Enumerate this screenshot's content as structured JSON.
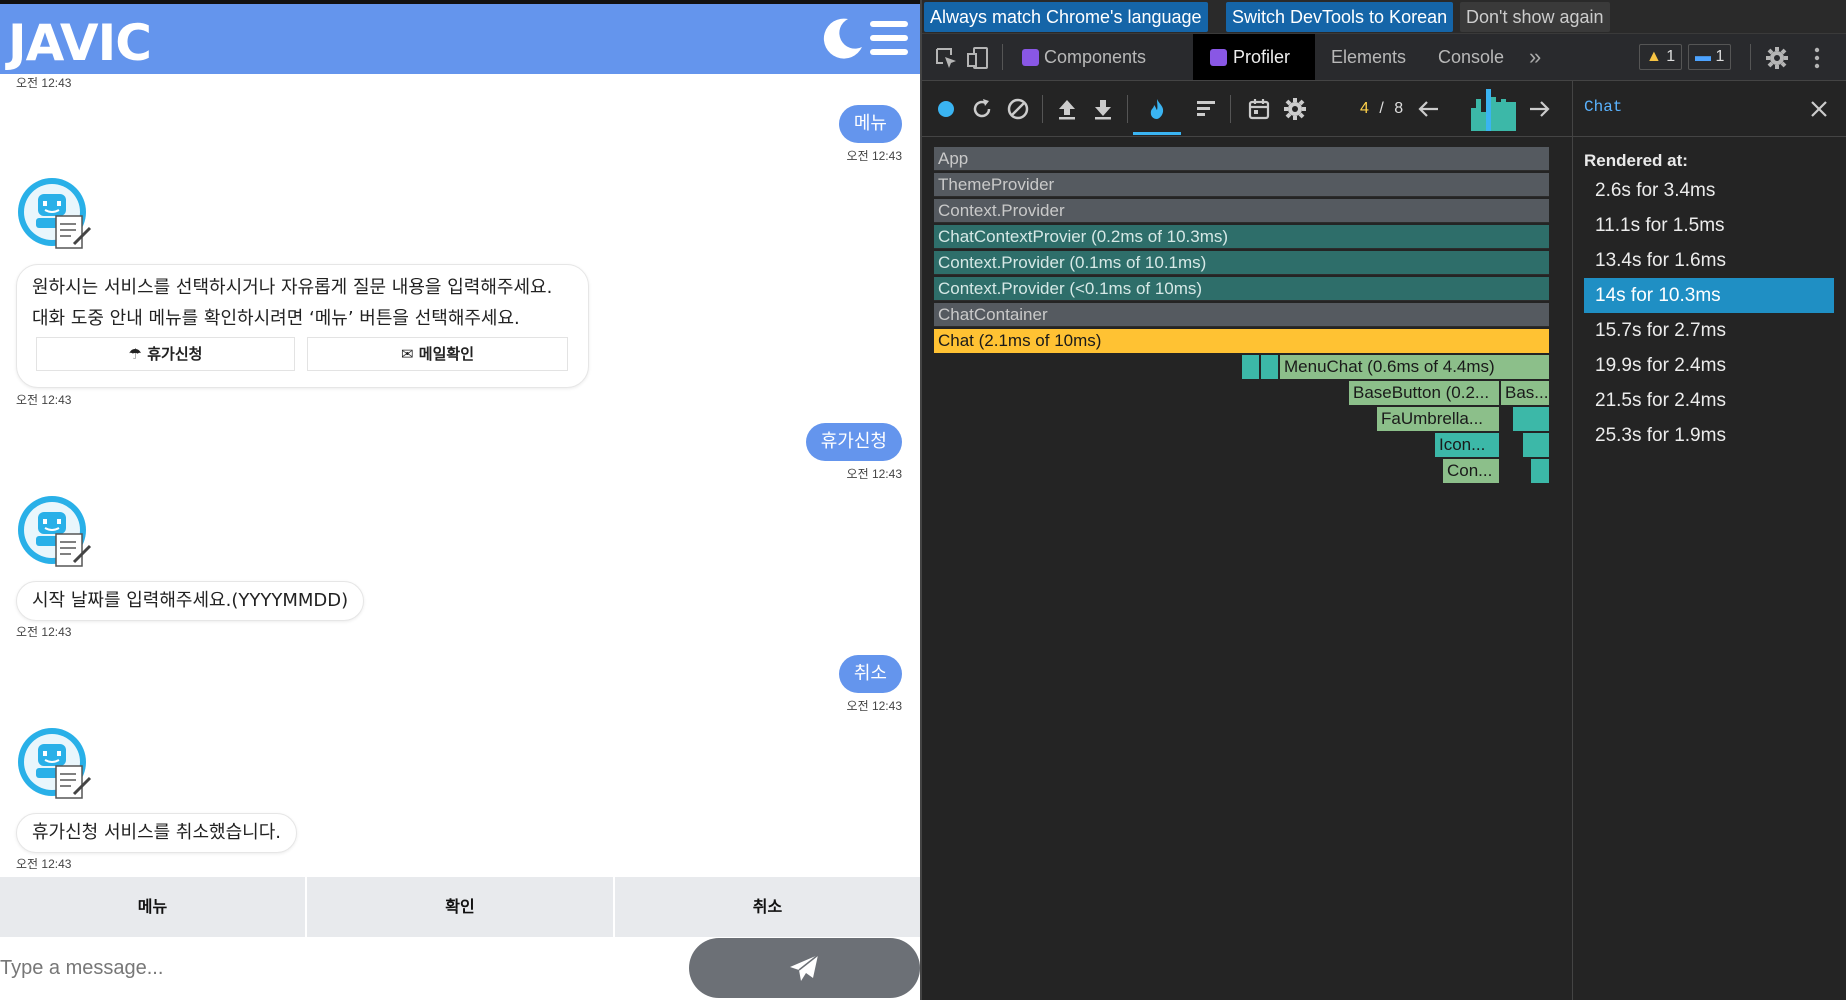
{
  "chat": {
    "brand": "JAVIC",
    "messages": [
      {
        "type": "time",
        "text": "오전 12:43"
      },
      {
        "type": "user",
        "text": "메뉴",
        "time": "오전 12:43"
      },
      {
        "type": "bot",
        "lines": [
          "원하시는 서비스를 선택하시거나 자유롭게 질문 내용을 입력해주세요.",
          "대화 도중 안내 메뉴를 확인하시려면 ‘메뉴’ 버튼을 선택해주세요."
        ],
        "buttons": [
          "휴가신청",
          "메일확인"
        ],
        "time": "오전 12:43"
      },
      {
        "type": "user",
        "text": "휴가신청",
        "time": "오전 12:43"
      },
      {
        "type": "bot",
        "lines": [
          "시작 날짜를 입력해주세요.(YYYYMMDD)"
        ],
        "time": "오전 12:43"
      },
      {
        "type": "user",
        "text": "취소",
        "time": "오전 12:43"
      },
      {
        "type": "bot",
        "lines": [
          "휴가신청 서비스를 취소했습니다."
        ],
        "time": "오전 12:43"
      }
    ],
    "quick_buttons": [
      "메뉴",
      "확인",
      "취소"
    ],
    "input_placeholder": "Type a message...",
    "colors": {
      "header": "#6495ed",
      "user_bubble": "#6495ed",
      "send_button": "#6c7076"
    },
    "icons": {
      "theme_toggle": "moon-icon",
      "menu": "hamburger-icon",
      "send": "paper-plane-icon",
      "bot": "robot-document-icon",
      "vacation": "umbrella-icon",
      "mail": "envelope-icon"
    }
  },
  "devtools": {
    "infobar": {
      "match_language": "Always match Chrome's language",
      "switch_korean": "Switch DevTools to Korean",
      "dont_show": "Don't show again"
    },
    "tabs": [
      "Components",
      "Profiler",
      "Elements",
      "Console"
    ],
    "active_tab": "Profiler",
    "warnings_count": "1",
    "messages_count": "1",
    "commit": {
      "current": "4",
      "separator": "/",
      "total": "8"
    },
    "commit_bars": [
      0.55,
      0.75,
      0.45,
      1.0,
      0.8,
      0.7,
      0.75,
      0.7,
      0.7
    ],
    "flamegraph": {
      "rows": [
        {
          "label": "App",
          "style": "gray"
        },
        {
          "label": "ThemeProvider",
          "style": "gray"
        },
        {
          "label": "Context.Provider",
          "style": "gray"
        },
        {
          "label": "ChatContextProvier (0.2ms of 10.3ms)",
          "style": "teal"
        },
        {
          "label": "Context.Provider (0.1ms of 10.1ms)",
          "style": "teal"
        },
        {
          "label": "Context.Provider (<0.1ms of 10ms)",
          "style": "teal"
        },
        {
          "label": "ChatContainer",
          "style": "gray"
        },
        {
          "label": "Chat (2.1ms of 10ms)",
          "style": "yellow"
        }
      ],
      "children": [
        "MenuChat (0.6ms of 4.4ms)",
        "BaseButton (0.2...",
        "Bas...",
        "FaUmbrella...",
        "Icon...",
        "Con..."
      ]
    },
    "sidebar": {
      "title": "Chat",
      "label": "Rendered at:",
      "renders": [
        "2.6s for 3.4ms",
        "11.1s for 1.5ms",
        "13.4s for 1.6ms",
        "14s for 10.3ms",
        "15.7s for 2.7ms",
        "19.9s for 2.4ms",
        "21.5s for 2.4ms",
        "25.3s for 1.9ms"
      ],
      "selected_index": 3
    },
    "colors": {
      "selected": "#1f8fc4",
      "flame_yellow": "#ffc233",
      "flame_teal": "#2e6e6a",
      "accent": "#5ab3ff"
    }
  }
}
